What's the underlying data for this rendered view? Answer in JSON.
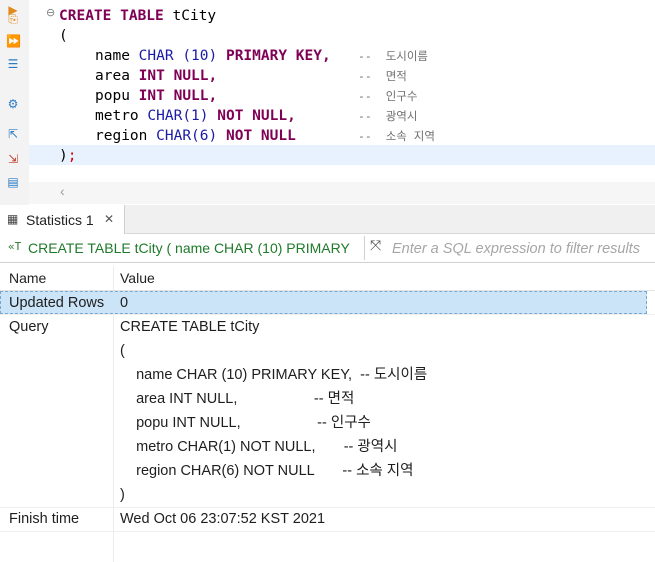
{
  "editor": {
    "create_line": {
      "kw": "CREATE TABLE",
      "name": "tCity"
    },
    "open_paren": "(",
    "close_paren": ")",
    "semicolon": ";",
    "columns": [
      {
        "name": "name",
        "type": "CHAR",
        "arg": "(10)",
        "constraint": "PRIMARY KEY,",
        "comment": "--  도시이름"
      },
      {
        "name": "area",
        "type": "INT",
        "arg": "",
        "constraint": "NULL,",
        "comment": "--  면적"
      },
      {
        "name": "popu",
        "type": "INT",
        "arg": "",
        "constraint": "NULL,",
        "comment": "--  인구수"
      },
      {
        "name": "metro",
        "type": "CHAR",
        "arg": "(1)",
        "constraint": "NOT NULL,",
        "comment": "--  광역시"
      },
      {
        "name": "region",
        "type": "CHAR",
        "arg": "(6)",
        "constraint": "NOT NULL",
        "comment": "--  소속 지역"
      }
    ]
  },
  "results": {
    "tab_label": "Statistics 1",
    "filter_query": "CREATE TABLE tCity ( name CHAR (10) PRIMARY",
    "filter_placeholder": "Enter a SQL expression to filter results",
    "headers": {
      "name": "Name",
      "value": "Value"
    },
    "rows": {
      "updated_rows": {
        "name": "Updated Rows",
        "value": "0"
      },
      "query": {
        "name": "Query",
        "lines": [
          "CREATE TABLE tCity",
          "(",
          "    name CHAR (10) PRIMARY KEY,  -- 도시이름",
          "    area INT NULL,                   -- 면적",
          "    popu INT NULL,                   -- 인구수",
          "    metro CHAR(1) NOT NULL,       -- 광역시",
          "    region CHAR(6) NOT NULL       -- 소속 지역",
          ")"
        ]
      },
      "finish_time": {
        "name": "Finish time",
        "value": "Wed Oct 06 23:07:52 KST 2021"
      }
    }
  },
  "icons": [
    "sql-file-icon",
    "run-script-icon",
    "explain-icon",
    "settings-icon",
    "export-icon",
    "import-icon",
    "format-icon",
    "statistics-icon",
    "close-icon",
    "query-icon",
    "expand-icon"
  ]
}
